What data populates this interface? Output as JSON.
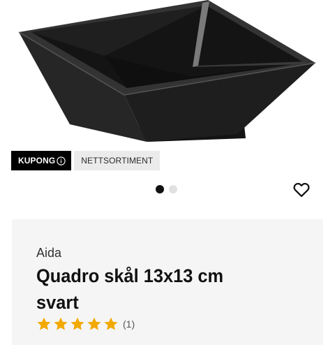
{
  "product": {
    "image_alt": "Quadro skål 13x13 cm svart",
    "badges": {
      "kupong": "KUPONG",
      "nettsortiment": "NETTSORTIMENT"
    },
    "carousel": {
      "total": 2,
      "active": 1
    },
    "brand": "Aida",
    "title": "Quadro skål 13x13 cm svart",
    "rating": {
      "stars": 5,
      "max": 5,
      "count_label": "(1)"
    }
  },
  "colors": {
    "star": "#f2a900",
    "badge_dark": "#000000",
    "badge_light": "#ebebeb",
    "card_bg": "#f5f5f5"
  },
  "icons": [
    "info-icon",
    "heart-icon",
    "star-icon"
  ]
}
